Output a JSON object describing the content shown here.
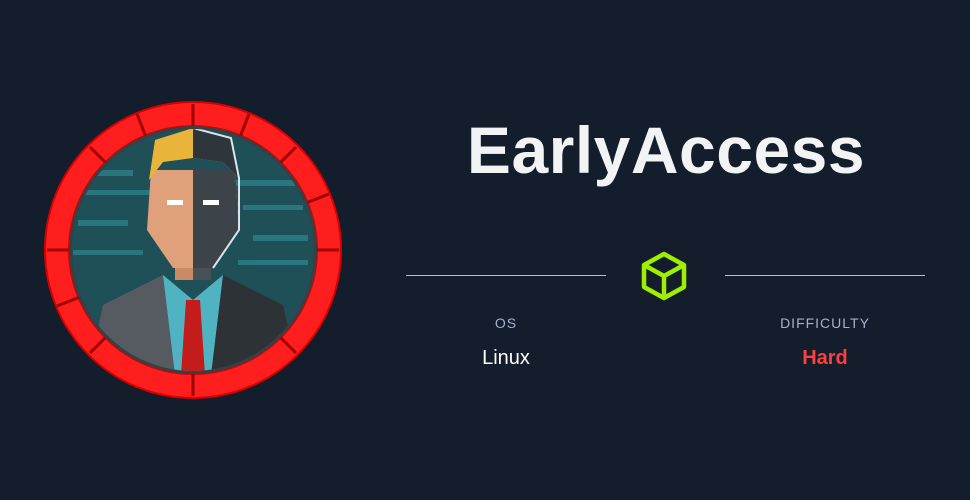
{
  "machine": {
    "name": "EarlyAccess",
    "os_label": "OS",
    "os_value": "Linux",
    "difficulty_label": "DIFFICULTY",
    "difficulty_value": "Hard"
  },
  "colors": {
    "background": "#141d2b",
    "accent": "#9fef00",
    "difficulty_hard": "#ff3e3e",
    "avatar_ring": "#ff1a1a",
    "muted_label": "#a4b1cd"
  },
  "icons": {
    "avatar": "machine-avatar-icon",
    "cube": "cube-icon"
  }
}
